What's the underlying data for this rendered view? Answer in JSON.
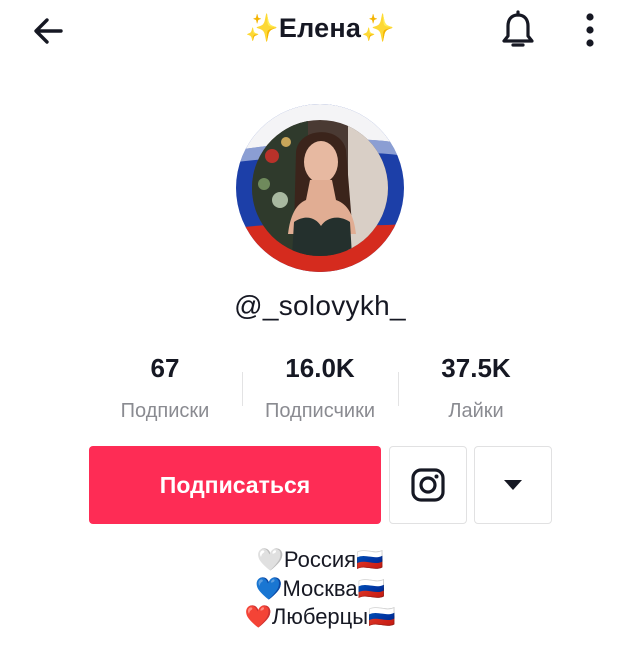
{
  "header": {
    "title": "✨Елена✨",
    "icons": {
      "back": "arrow-left-icon",
      "bell": "bell-icon",
      "more": "more-vertical-icon"
    }
  },
  "profile": {
    "username": "@_solovykh_",
    "avatar_flag_colors": [
      "#ffffff",
      "#1c3fa8",
      "#d52b1e"
    ]
  },
  "stats": [
    {
      "value": "67",
      "label": "Подписки"
    },
    {
      "value": "16.0K",
      "label": "Подписчики"
    },
    {
      "value": "37.5K",
      "label": "Лайки"
    }
  ],
  "actions": {
    "follow_label": "Подписаться",
    "instagram_icon": "instagram-icon",
    "dropdown_icon": "triangle-down-icon"
  },
  "bio": [
    "🤍Россия🇷🇺",
    "💙Москва🇷🇺",
    "❤️Люберцы🇷🇺"
  ],
  "colors": {
    "accent": "#fe2c55",
    "text": "#161823",
    "secondary_text": "#8a8b91"
  }
}
